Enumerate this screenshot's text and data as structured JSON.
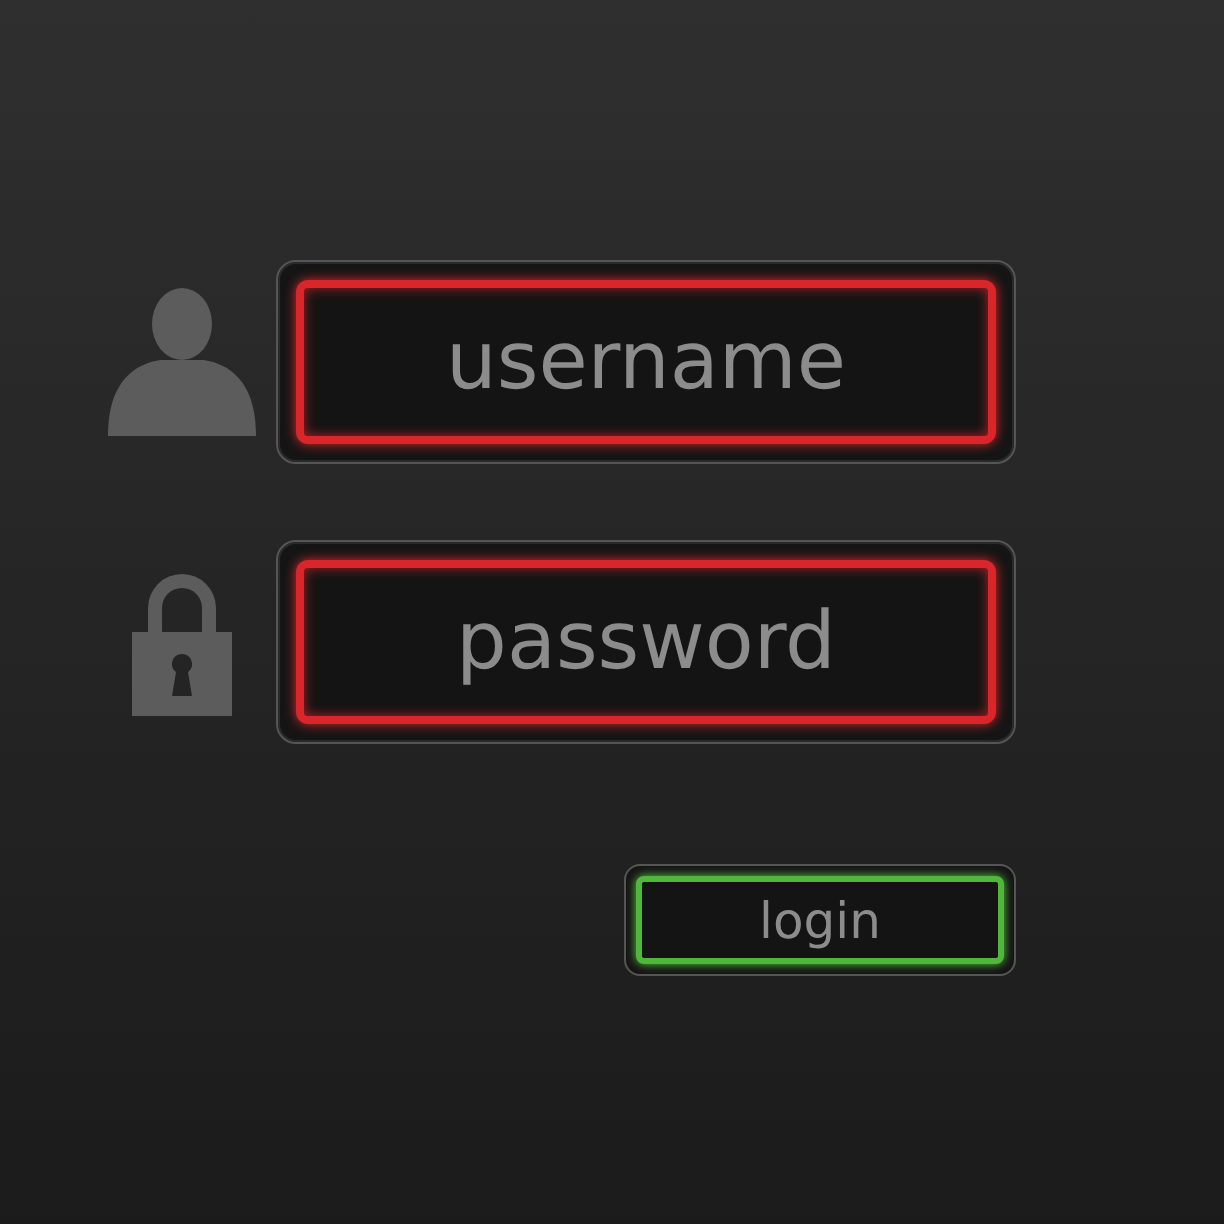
{
  "fields": [
    {
      "kind": "user",
      "placeholder": "username"
    },
    {
      "kind": "password",
      "placeholder": "password"
    }
  ],
  "button": {
    "label": "login"
  }
}
